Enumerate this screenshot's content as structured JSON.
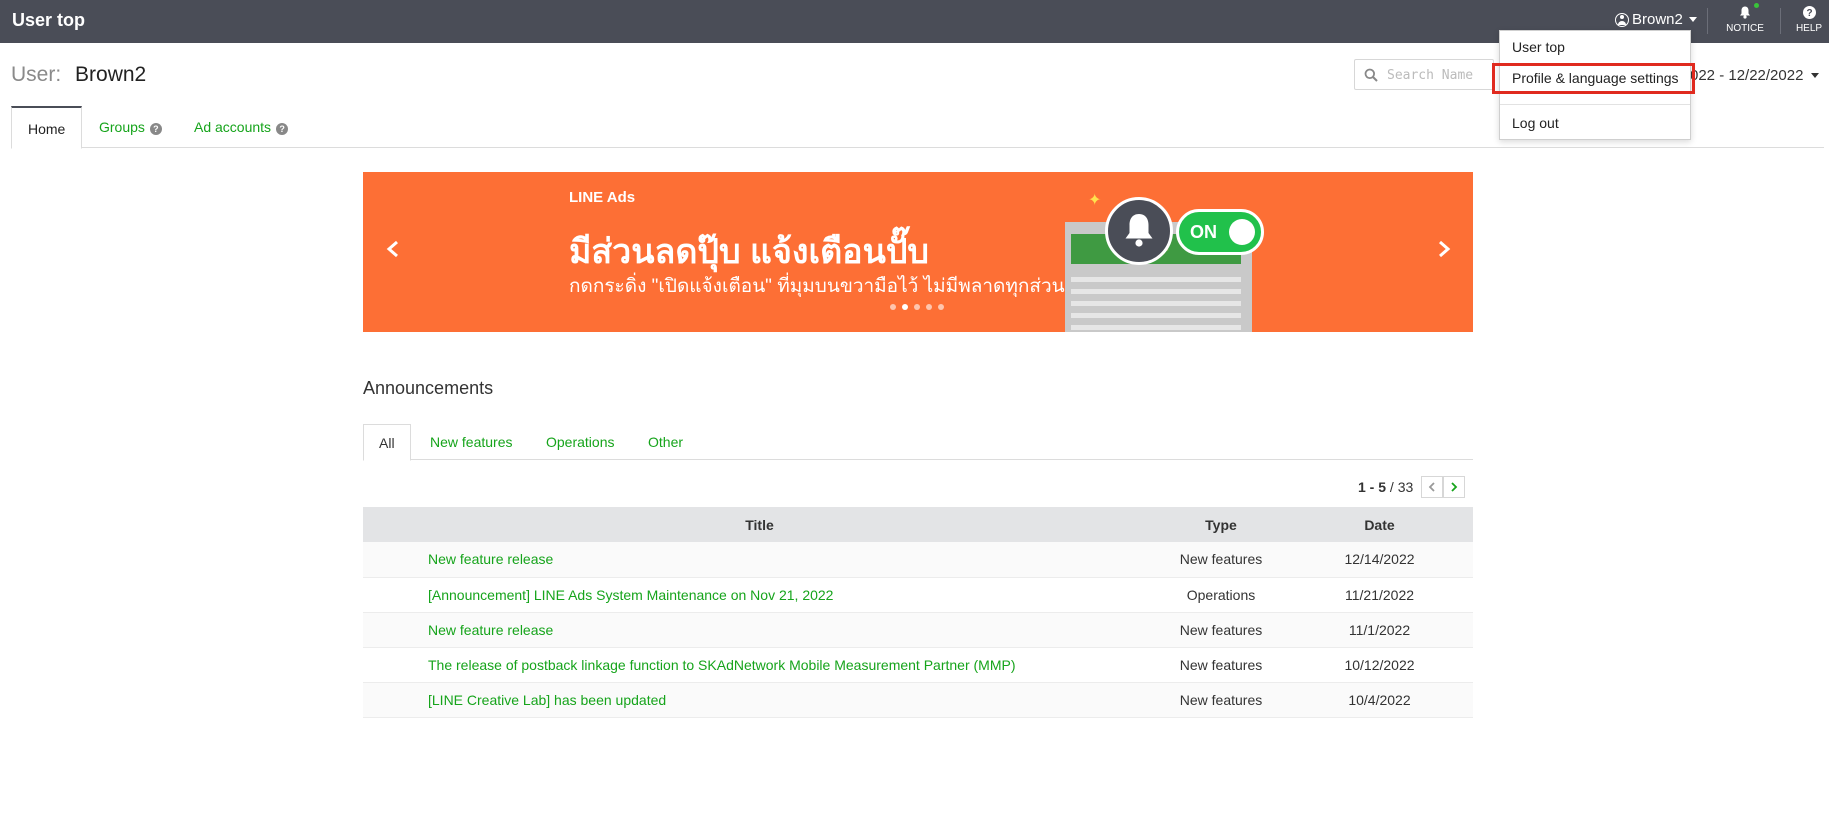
{
  "header": {
    "title": "User top",
    "user_name": "Brown2",
    "notice_label": "NOTICE",
    "help_label": "HELP"
  },
  "user": {
    "label": "User:",
    "name": "Brown2"
  },
  "search": {
    "placeholder": "Search Name"
  },
  "date_range": "022 - 12/22/2022",
  "tabs": [
    {
      "label": "Home"
    },
    {
      "label": "Groups"
    },
    {
      "label": "Ad accounts"
    }
  ],
  "banner": {
    "brand": "LINE Ads",
    "headline": "มีส่วนลดปุ๊บ แจ้งเตือนปั๊บ",
    "subline": "กดกระดิ่ง \"เปิดแจ้งเตือน\" ที่มุมบนขวามือไว้ ไม่มีพลาดทุกส่วนลด",
    "toggle_text": "ON",
    "dot_count": 5,
    "active_dot": 1
  },
  "announcements": {
    "title": "Announcements",
    "tabs": [
      {
        "label": "All"
      },
      {
        "label": "New features"
      },
      {
        "label": "Operations"
      },
      {
        "label": "Other"
      }
    ],
    "pager": {
      "range": "1 - 5",
      "separator": "/",
      "total": "33"
    },
    "columns": {
      "title": "Title",
      "type": "Type",
      "date": "Date"
    },
    "rows": [
      {
        "title": "New feature release",
        "type": "New features",
        "date": "12/14/2022"
      },
      {
        "title": "[Announcement] LINE Ads System Maintenance on Nov 21, 2022",
        "type": "Operations",
        "date": "11/21/2022"
      },
      {
        "title": "New feature release",
        "type": "New features",
        "date": "11/1/2022"
      },
      {
        "title": "The release of postback linkage function to SKAdNetwork Mobile Measurement Partner (MMP)",
        "type": "New features",
        "date": "10/12/2022"
      },
      {
        "title": "[LINE Creative Lab] has been updated",
        "type": "New features",
        "date": "10/4/2022"
      }
    ]
  },
  "dropdown": {
    "items": [
      {
        "label": "User top"
      },
      {
        "label": "Profile & language settings"
      },
      {
        "label": "Log out"
      }
    ]
  },
  "colors": {
    "header_bg": "#4a4d57",
    "link_green": "#16a41b",
    "banner_orange": "#fd6f35",
    "highlight_red": "#e02a1f"
  }
}
